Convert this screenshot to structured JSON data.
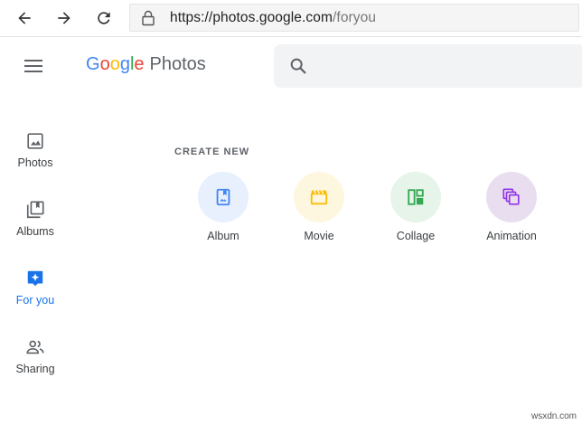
{
  "browser": {
    "url_host": "https://photos.google.com",
    "url_path": "/foryou"
  },
  "header": {
    "brand_letters": [
      "G",
      "o",
      "o",
      "g",
      "l",
      "e"
    ],
    "product": "Photos"
  },
  "sidebar": {
    "items": [
      {
        "label": "Photos",
        "icon": "photo-icon",
        "active": false
      },
      {
        "label": "Albums",
        "icon": "albums-icon",
        "active": false
      },
      {
        "label": "For you",
        "icon": "for-you-icon",
        "active": true
      },
      {
        "label": "Sharing",
        "icon": "people-icon",
        "active": false
      }
    ],
    "active_color": "#1a73e8"
  },
  "create_new": {
    "title": "CREATE NEW",
    "items": [
      {
        "label": "Album",
        "icon": "album-icon",
        "bg": "#e8f0fe",
        "color": "#4285f4"
      },
      {
        "label": "Movie",
        "icon": "movie-icon",
        "bg": "#fef7e0",
        "color": "#fbbc04"
      },
      {
        "label": "Collage",
        "icon": "collage-icon",
        "bg": "#e6f4ea",
        "color": "#34a853"
      },
      {
        "label": "Animation",
        "icon": "animation-icon",
        "bg": "#e8def0",
        "color": "#9334e6"
      }
    ]
  },
  "watermark": "wsxdn.com"
}
